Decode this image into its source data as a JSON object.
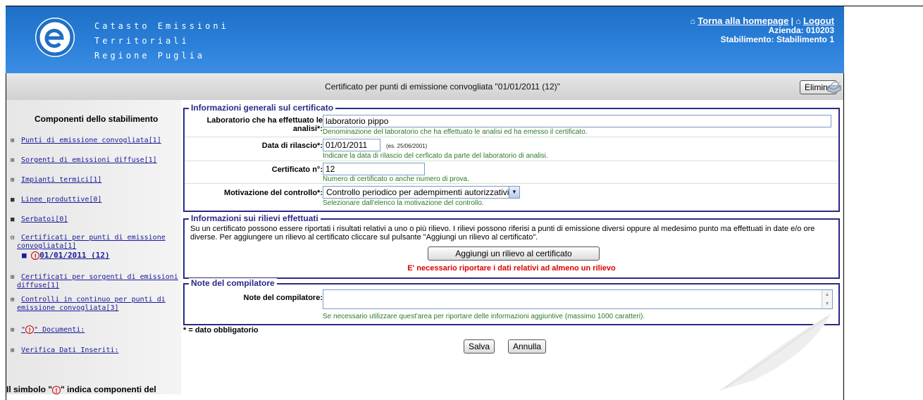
{
  "header": {
    "title_lines": [
      "Catasto Emissioni",
      "Territoriali",
      "Regione Puglia"
    ],
    "home_link": "Torna alla homepage",
    "logout_link": "Logout",
    "azienda": "Azienda: 010203",
    "stabilimento": "Stabilimento: Stabilimento 1"
  },
  "titlebar": {
    "title": "Certificato per punti di emissione convogliata \"01/01/2011 (12)\"",
    "delete_label": "Elimina"
  },
  "sidebar": {
    "heading": "Componenti dello stabilimento",
    "items": [
      {
        "marker": "⊞",
        "label": "Punti di emissione convogliata[1]"
      },
      {
        "marker": "⊞",
        "label": "Sorgenti di emissioni diffuse[1]"
      },
      {
        "marker": "⊞",
        "label": "Impianti termici[1]"
      },
      {
        "marker": "■",
        "label": "Linee produttive[0]"
      },
      {
        "marker": "■",
        "label": "Serbatoi[0]"
      },
      {
        "marker": "⊟",
        "label_line1": "Certificati per punti di emissione",
        "label_line2": "convogliata[1]"
      },
      {
        "marker": "⊞",
        "label_line1": "Certificati per sorgenti di emissioni",
        "label_line2": "diffuse[1]"
      },
      {
        "marker": "⊞",
        "label_line1": "Controlli in continuo per punti di",
        "label_line2": "emissione convogliata[3]"
      },
      {
        "marker": "⊞",
        "label_prefix": "\"",
        "label_suffix": "\" Documenti:"
      },
      {
        "marker": "⊞",
        "label": "Verifica Dati Inseriti:"
      }
    ],
    "current_item": "01/01/2011 (12)",
    "alert_glyph": "!",
    "footer_prefix": "Il simbolo \"",
    "footer_suffix": "\" indica componenti del"
  },
  "section_general": {
    "legend": "Informazioni generali sul certificato",
    "lab_label_line1": "Laboratorio che ha effettuato le",
    "lab_label_line2": "analisi*:",
    "lab_value": "laboratorio pippo",
    "lab_hint": "Denominazione del laboratorio che ha effettuato le analisi ed ha emesso il certificato.",
    "date_label": "Data di rilascio*:",
    "date_value": "01/01/2011",
    "date_example": "(es. 25/06/2001)",
    "date_hint": "Indicare la data di rilascio del cerficato da parte del laboratorio di analisi.",
    "cert_label": "Certificato n°:",
    "cert_value": "12",
    "cert_hint": "Numero di certificato o anche numero di prova.",
    "motivo_label": "Motivazione del controllo*:",
    "motivo_value": "Controllo periodico per adempimenti autorizzativi",
    "motivo_hint": "Selezionare dall'elenco la motivazione del controllo."
  },
  "section_rilievi": {
    "legend": "Informazioni sui rilievi effettuati",
    "description": "Su un certificato possono essere riportati i  risultati relativi a uno o più rilievo. I rilievi possono riferisi a punti di emissione diversi oppure al medesimo punto ma effettuati in date e/o ore diverse. Per aggiungere un rilievo al certificato cliccare sul pulsante \"Aggiungi un rilievo al certificato\".",
    "add_button": "Aggiungi un rilievo al certificato",
    "error": "E' necessario riportare i dati relativi ad almeno un rilievo"
  },
  "section_note": {
    "legend": "Note del compilatore",
    "label": "Note del compilatore:",
    "value": "",
    "hint": "Se necessario utilizzare quest'area per riportare delle informazioni aggiuntive (massimo 1000 caratteri)."
  },
  "form": {
    "required_note": "* = dato obbligatorio",
    "save_label": "Salva",
    "cancel_label": "Annulla"
  }
}
